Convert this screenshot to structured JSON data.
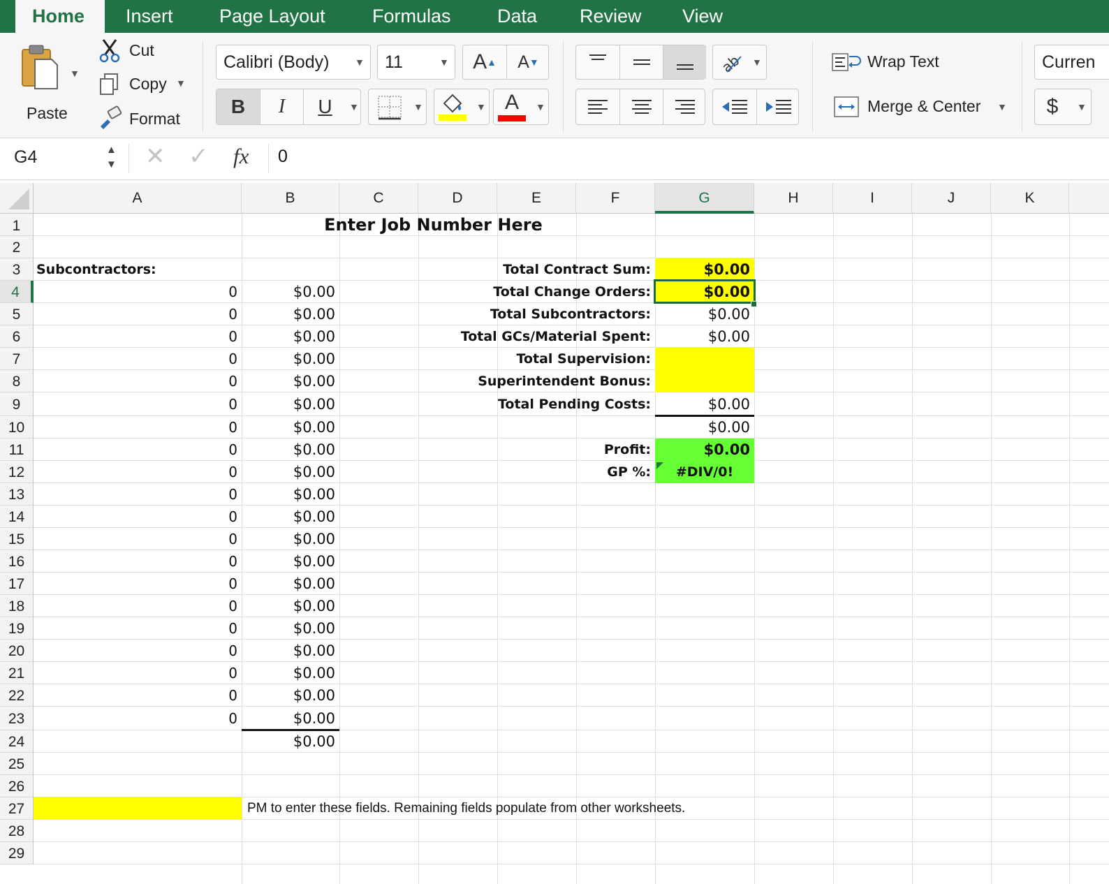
{
  "ribbon_tabs": [
    "Home",
    "Insert",
    "Page Layout",
    "Formulas",
    "Data",
    "Review",
    "View"
  ],
  "clipboard": {
    "paste": "Paste",
    "cut": "Cut",
    "copy": "Copy",
    "format": "Format"
  },
  "font": {
    "name": "Calibri (Body)",
    "size": "11",
    "bold": "B",
    "italic": "I",
    "underline": "U",
    "font_color_glyph": "A"
  },
  "alignment": {
    "wrap_text": "Wrap Text",
    "merge_center": "Merge & Center"
  },
  "number": {
    "format": "Curren",
    "currency_symbol": "$"
  },
  "colors": {
    "ribbon_green": "#217346",
    "highlight_yellow": "#ffff00",
    "profit_green": "#66ff33",
    "font_red": "#ff0000"
  },
  "formula_bar": {
    "name_box": "G4",
    "fx": "fx",
    "content": "0"
  },
  "columns": [
    "A",
    "B",
    "C",
    "D",
    "E",
    "F",
    "G",
    "H",
    "I",
    "J",
    "K"
  ],
  "rows": [
    "1",
    "2",
    "3",
    "4",
    "5",
    "6",
    "7",
    "8",
    "9",
    "10",
    "11",
    "12",
    "13",
    "14",
    "15",
    "16",
    "17",
    "18",
    "19",
    "20",
    "21",
    "22",
    "23",
    "24",
    "25",
    "26",
    "27",
    "28",
    "29"
  ],
  "sheet": {
    "title": "Enter Job Number Here",
    "subcontractors_label": "Subcontractors:",
    "sub_values": [
      "0",
      "0",
      "0",
      "0",
      "0",
      "0",
      "0",
      "0",
      "0",
      "0",
      "0",
      "0",
      "0",
      "0",
      "0",
      "0",
      "0",
      "0",
      "0",
      "0"
    ],
    "sub_amounts": [
      "$0.00",
      "$0.00",
      "$0.00",
      "$0.00",
      "$0.00",
      "$0.00",
      "$0.00",
      "$0.00",
      "$0.00",
      "$0.00",
      "$0.00",
      "$0.00",
      "$0.00",
      "$0.00",
      "$0.00",
      "$0.00",
      "$0.00",
      "$0.00",
      "$0.00",
      "$0.00"
    ],
    "sub_total": "$0.00",
    "summary": [
      {
        "label": "Total Contract Sum:",
        "value": "$0.00"
      },
      {
        "label": "Total Change Orders:",
        "value": "$0.00"
      },
      {
        "label": "Total Subcontractors:",
        "value": "$0.00"
      },
      {
        "label": "Total GCs/Material Spent:",
        "value": "$0.00"
      },
      {
        "label": "Total Supervision:",
        "value": ""
      },
      {
        "label": "Superintendent Bonus:",
        "value": ""
      },
      {
        "label": "Total Pending Costs:",
        "value": "$0.00"
      }
    ],
    "summary_total": "$0.00",
    "profit_label": "Profit:",
    "profit_value": "$0.00",
    "gp_label": "GP %:",
    "gp_value": "#DIV/0!",
    "legend_note": "PM to enter these fields. Remaining fields populate from other worksheets."
  }
}
